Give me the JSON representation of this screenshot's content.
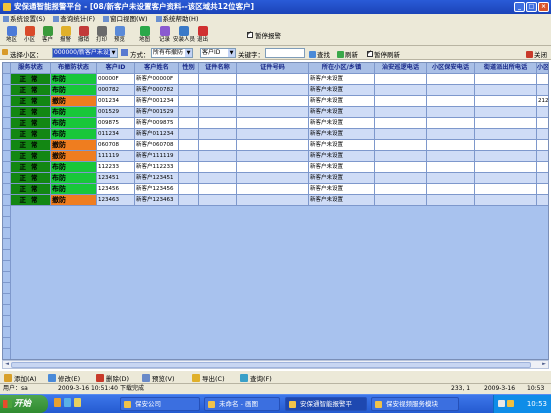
{
  "window": {
    "title": "安保通智能报警平台 - [08/新客户未设置客户资料--该区域共12位客户]"
  },
  "menu": [
    "系统设置(S)",
    "查询统计(F)",
    "窗口视图(W)",
    "系统帮助(H)"
  ],
  "toolbar": {
    "buttons": [
      "地区",
      "小区",
      "客户",
      "报警",
      "撤销",
      "打印",
      "预览",
      "地图",
      "记录",
      "安装人员",
      "退出"
    ],
    "pause_alarm_label": "暂停报警"
  },
  "filter": {
    "zone_label": "选择小区：",
    "zone_value": "000000/新客户未设置",
    "mode_label": "方式：",
    "mode_value": "所有布撤防",
    "field_value": "客户ID",
    "keyword_label": "关键字：",
    "keyword_value": "",
    "find_label": "查找",
    "refresh_label": "刷新",
    "pause_refresh_label": "暂停刷新",
    "close_label": "关闭"
  },
  "table": {
    "columns": [
      "服务状态",
      "布撤防状态",
      "客户ID",
      "客户姓名",
      "性别",
      "证件名称",
      "证件号码",
      "所在小区/乡镇",
      "治安巡逻电话",
      "小区保安电话",
      "街道派出所电话",
      "小区"
    ],
    "rows": [
      {
        "service": "正常",
        "arm": "布防",
        "id": "00000F",
        "name": "新客户00000F",
        "zone": "新客户未设置",
        "extra": ""
      },
      {
        "service": "正常",
        "arm": "布防",
        "id": "000782",
        "name": "新客户000782",
        "zone": "新客户未设置",
        "extra": ""
      },
      {
        "service": "正常",
        "arm": "撤防",
        "id": "001234",
        "name": "新客户001234",
        "zone": "新客户未设置",
        "extra": "212"
      },
      {
        "service": "正常",
        "arm": "布防",
        "id": "001529",
        "name": "新客户001529",
        "zone": "新客户未设置",
        "extra": ""
      },
      {
        "service": "正常",
        "arm": "布防",
        "id": "009875",
        "name": "新客户009875",
        "zone": "新客户未设置",
        "extra": ""
      },
      {
        "service": "正常",
        "arm": "布防",
        "id": "011234",
        "name": "新客户011234",
        "zone": "新客户未设置",
        "extra": ""
      },
      {
        "service": "正常",
        "arm": "撤防",
        "id": "060708",
        "name": "新客户060708",
        "zone": "新客户未设置",
        "extra": ""
      },
      {
        "service": "正常",
        "arm": "撤防",
        "id": "111119",
        "name": "新客户111119",
        "zone": "新客户未设置",
        "extra": ""
      },
      {
        "service": "正常",
        "arm": "布防",
        "id": "112233",
        "name": "新客户112233",
        "zone": "新客户未设置",
        "extra": ""
      },
      {
        "service": "正常",
        "arm": "布防",
        "id": "123451",
        "name": "新客户123451",
        "zone": "新客户未设置",
        "extra": ""
      },
      {
        "service": "正常",
        "arm": "布防",
        "id": "123456",
        "name": "新客户123456",
        "zone": "新客户未设置",
        "extra": ""
      },
      {
        "service": "正常",
        "arm": "撤防",
        "id": "123463",
        "name": "新客户123463",
        "zone": "新客户未设置",
        "extra": ""
      }
    ],
    "armed_color": "#18c73a",
    "disarmed_color": "#ef7d1f",
    "service_color": "#138713"
  },
  "actions": [
    "添加(A)",
    "修改(E)",
    "删除(D)",
    "预览(V)",
    "导出(C)",
    "查询(F)"
  ],
  "status": {
    "user": "用户：sa",
    "datetime": "2009-3-16 10:51:40",
    "message": "下载完成",
    "position": "233, 1",
    "date": "2009-3-16",
    "time": "10:53"
  },
  "taskbar": {
    "start": "开始",
    "tasks": [
      "保安公司",
      "未命名 - 画图",
      "安保通智能报警平",
      "保安视频服务模块"
    ],
    "clock": "10:53"
  }
}
